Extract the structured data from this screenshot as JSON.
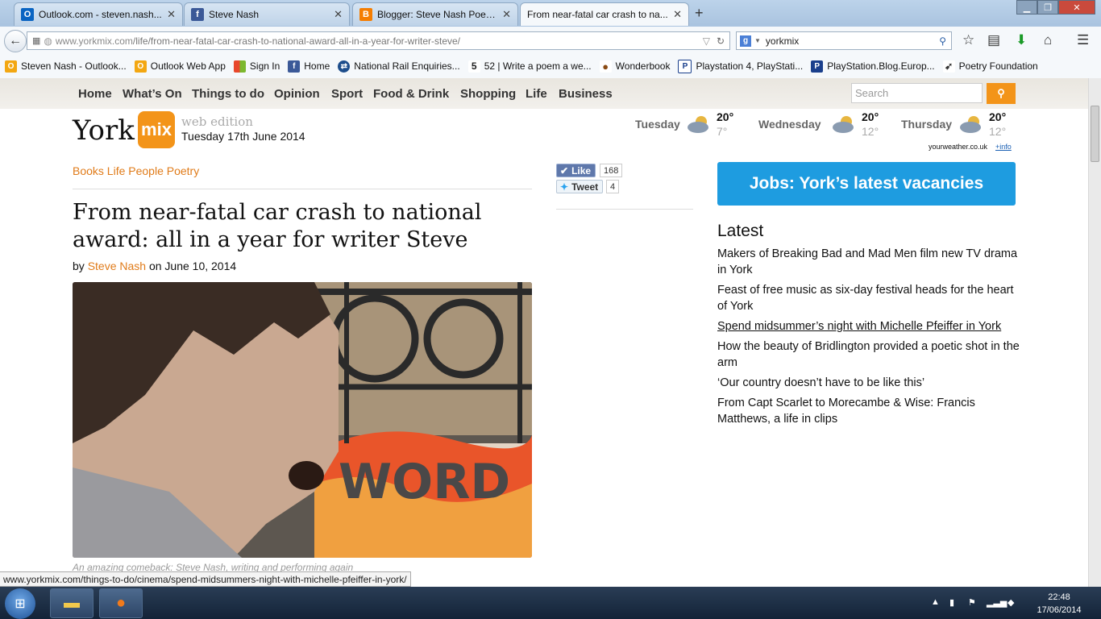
{
  "browser": {
    "tabs": [
      {
        "label": "Outlook.com - steven.nash...",
        "icon": "outlook-icon",
        "color": "#0a64c2",
        "active": false
      },
      {
        "label": "Steve Nash",
        "icon": "facebook-icon",
        "color": "#3b5998",
        "active": false
      },
      {
        "label": "Blogger: Steve Nash Poetry...",
        "icon": "blogger-icon",
        "color": "#f57d00",
        "active": false
      },
      {
        "label": "From near-fatal car crash to na...",
        "icon": "yorkmix-icon",
        "color": "#f39419",
        "active": true
      }
    ],
    "url": {
      "domain": "www.yorkmix.com",
      "path": "/life/from-near-fatal-car-crash-to-national-award-all-in-a-year-for-writer-steve/"
    },
    "search_value": "yorkmix",
    "bookmarks": [
      {
        "label": "Steven Nash - Outlook...",
        "icon": "outlook-icon",
        "color": "#f3a712"
      },
      {
        "label": "Outlook Web App",
        "icon": "outlook-icon",
        "color": "#f3a712"
      },
      {
        "label": "Sign In",
        "icon": "microsoft-icon",
        "color": "#e8472b"
      },
      {
        "label": "Home",
        "icon": "facebook-icon",
        "color": "#3b5998"
      },
      {
        "label": "National Rail Enquiries...",
        "icon": "national-rail-icon",
        "color": "#1d4d8c"
      },
      {
        "label": "52 | Write a poem a we...",
        "icon": "fifty-two-icon",
        "color": "#222222"
      },
      {
        "label": "Wonderbook",
        "icon": "balloon-icon",
        "color": "#8a4b14"
      },
      {
        "label": "Playstation 4, PlayStati...",
        "icon": "playstation-icon",
        "color": "#1a3f8c"
      },
      {
        "label": "PlayStation.Blog.Europ...",
        "icon": "playstation-icon",
        "color": "#1a3f8c"
      },
      {
        "label": "Poetry Foundation",
        "icon": "pegasus-icon",
        "color": "#333333"
      }
    ],
    "status_url": "www.yorkmix.com/things-to-do/cinema/spend-midsummers-night-with-michelle-pfeiffer-in-york/"
  },
  "site": {
    "nav": [
      "Home",
      "What’s On",
      "Things to do",
      "Opinion",
      "Sport",
      "Food & Drink",
      "Shopping",
      "Life",
      "Business"
    ],
    "search_placeholder": "Search",
    "logo_text": "York",
    "logo_mark": "mix",
    "edition": "web edition",
    "date": "Tuesday 17th June 2014",
    "weather": [
      {
        "day": "Tuesday",
        "high": "20°",
        "low": "7°"
      },
      {
        "day": "Wednesday",
        "high": "20°",
        "low": "12°"
      },
      {
        "day": "Thursday",
        "high": "20°",
        "low": "12°"
      }
    ],
    "weather_credit": "yourweather.co.uk",
    "weather_info": "+info",
    "accent": "#f39419"
  },
  "article": {
    "categories": "Books Life People Poetry",
    "headline": "From near-fatal car crash to national award: all in a year for writer Steve",
    "by": "by",
    "author": "Steve Nash",
    "on_date": "on June 10, 2014",
    "photo_text": "WORD",
    "caption": "An amazing comeback: Steve Nash, writing and performing again"
  },
  "social": {
    "like_label": "Like",
    "like_count": "168",
    "tweet_label": "Tweet",
    "tweet_count": "4"
  },
  "sidebar": {
    "jobs_label": "Jobs: York’s latest vacancies",
    "latest_title": "Latest",
    "latest": [
      "Makers of Breaking Bad and Mad Men film new TV drama in York",
      "Feast of free music as six-day festival heads for the heart of York",
      "Spend midsummer’s night with Michelle Pfeiffer in York",
      "How the beauty of Bridlington provided a poetic shot in the arm",
      "‘Our country doesn’t have to be like this’",
      "From Capt Scarlet to Morecambe & Wise: Francis Matthews, a life in clips"
    ]
  },
  "taskbar": {
    "time": "22:48",
    "date": "17/06/2014"
  }
}
